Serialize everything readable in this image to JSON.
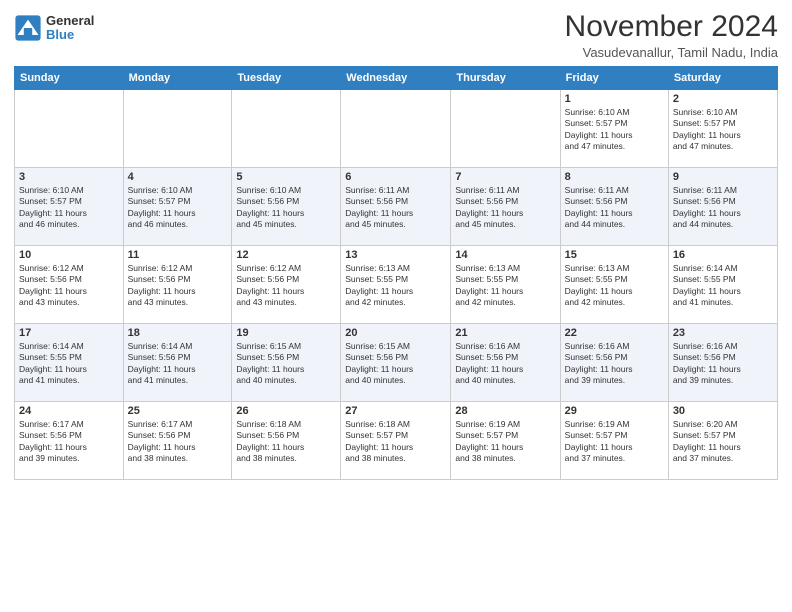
{
  "logo": {
    "general": "General",
    "blue": "Blue"
  },
  "title": "November 2024",
  "location": "Vasudevanallur, Tamil Nadu, India",
  "days_of_week": [
    "Sunday",
    "Monday",
    "Tuesday",
    "Wednesday",
    "Thursday",
    "Friday",
    "Saturday"
  ],
  "weeks": [
    [
      {
        "day": "",
        "info": ""
      },
      {
        "day": "",
        "info": ""
      },
      {
        "day": "",
        "info": ""
      },
      {
        "day": "",
        "info": ""
      },
      {
        "day": "",
        "info": ""
      },
      {
        "day": "1",
        "info": "Sunrise: 6:10 AM\nSunset: 5:57 PM\nDaylight: 11 hours\nand 47 minutes."
      },
      {
        "day": "2",
        "info": "Sunrise: 6:10 AM\nSunset: 5:57 PM\nDaylight: 11 hours\nand 47 minutes."
      }
    ],
    [
      {
        "day": "3",
        "info": "Sunrise: 6:10 AM\nSunset: 5:57 PM\nDaylight: 11 hours\nand 46 minutes."
      },
      {
        "day": "4",
        "info": "Sunrise: 6:10 AM\nSunset: 5:57 PM\nDaylight: 11 hours\nand 46 minutes."
      },
      {
        "day": "5",
        "info": "Sunrise: 6:10 AM\nSunset: 5:56 PM\nDaylight: 11 hours\nand 45 minutes."
      },
      {
        "day": "6",
        "info": "Sunrise: 6:11 AM\nSunset: 5:56 PM\nDaylight: 11 hours\nand 45 minutes."
      },
      {
        "day": "7",
        "info": "Sunrise: 6:11 AM\nSunset: 5:56 PM\nDaylight: 11 hours\nand 45 minutes."
      },
      {
        "day": "8",
        "info": "Sunrise: 6:11 AM\nSunset: 5:56 PM\nDaylight: 11 hours\nand 44 minutes."
      },
      {
        "day": "9",
        "info": "Sunrise: 6:11 AM\nSunset: 5:56 PM\nDaylight: 11 hours\nand 44 minutes."
      }
    ],
    [
      {
        "day": "10",
        "info": "Sunrise: 6:12 AM\nSunset: 5:56 PM\nDaylight: 11 hours\nand 43 minutes."
      },
      {
        "day": "11",
        "info": "Sunrise: 6:12 AM\nSunset: 5:56 PM\nDaylight: 11 hours\nand 43 minutes."
      },
      {
        "day": "12",
        "info": "Sunrise: 6:12 AM\nSunset: 5:56 PM\nDaylight: 11 hours\nand 43 minutes."
      },
      {
        "day": "13",
        "info": "Sunrise: 6:13 AM\nSunset: 5:55 PM\nDaylight: 11 hours\nand 42 minutes."
      },
      {
        "day": "14",
        "info": "Sunrise: 6:13 AM\nSunset: 5:55 PM\nDaylight: 11 hours\nand 42 minutes."
      },
      {
        "day": "15",
        "info": "Sunrise: 6:13 AM\nSunset: 5:55 PM\nDaylight: 11 hours\nand 42 minutes."
      },
      {
        "day": "16",
        "info": "Sunrise: 6:14 AM\nSunset: 5:55 PM\nDaylight: 11 hours\nand 41 minutes."
      }
    ],
    [
      {
        "day": "17",
        "info": "Sunrise: 6:14 AM\nSunset: 5:55 PM\nDaylight: 11 hours\nand 41 minutes."
      },
      {
        "day": "18",
        "info": "Sunrise: 6:14 AM\nSunset: 5:56 PM\nDaylight: 11 hours\nand 41 minutes."
      },
      {
        "day": "19",
        "info": "Sunrise: 6:15 AM\nSunset: 5:56 PM\nDaylight: 11 hours\nand 40 minutes."
      },
      {
        "day": "20",
        "info": "Sunrise: 6:15 AM\nSunset: 5:56 PM\nDaylight: 11 hours\nand 40 minutes."
      },
      {
        "day": "21",
        "info": "Sunrise: 6:16 AM\nSunset: 5:56 PM\nDaylight: 11 hours\nand 40 minutes."
      },
      {
        "day": "22",
        "info": "Sunrise: 6:16 AM\nSunset: 5:56 PM\nDaylight: 11 hours\nand 39 minutes."
      },
      {
        "day": "23",
        "info": "Sunrise: 6:16 AM\nSunset: 5:56 PM\nDaylight: 11 hours\nand 39 minutes."
      }
    ],
    [
      {
        "day": "24",
        "info": "Sunrise: 6:17 AM\nSunset: 5:56 PM\nDaylight: 11 hours\nand 39 minutes."
      },
      {
        "day": "25",
        "info": "Sunrise: 6:17 AM\nSunset: 5:56 PM\nDaylight: 11 hours\nand 38 minutes."
      },
      {
        "day": "26",
        "info": "Sunrise: 6:18 AM\nSunset: 5:56 PM\nDaylight: 11 hours\nand 38 minutes."
      },
      {
        "day": "27",
        "info": "Sunrise: 6:18 AM\nSunset: 5:57 PM\nDaylight: 11 hours\nand 38 minutes."
      },
      {
        "day": "28",
        "info": "Sunrise: 6:19 AM\nSunset: 5:57 PM\nDaylight: 11 hours\nand 38 minutes."
      },
      {
        "day": "29",
        "info": "Sunrise: 6:19 AM\nSunset: 5:57 PM\nDaylight: 11 hours\nand 37 minutes."
      },
      {
        "day": "30",
        "info": "Sunrise: 6:20 AM\nSunset: 5:57 PM\nDaylight: 11 hours\nand 37 minutes."
      }
    ]
  ]
}
